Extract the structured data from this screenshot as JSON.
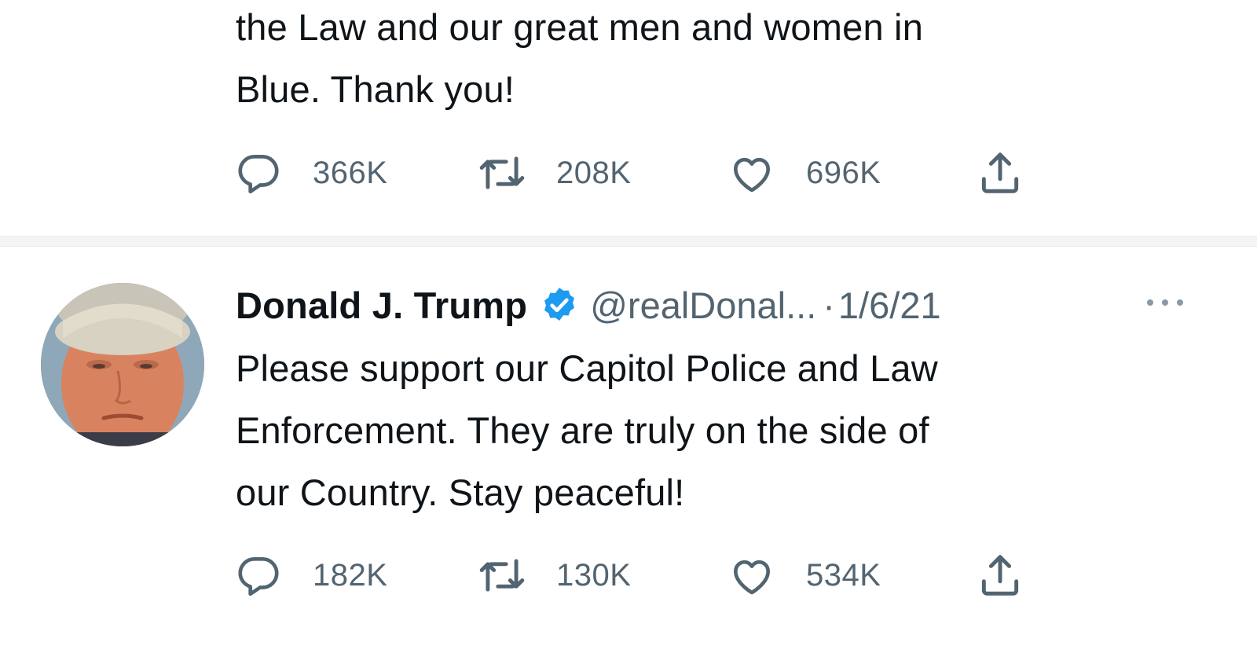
{
  "tweets": [
    {
      "text_lines": [
        "the Law and our great men and women in",
        "Blue. Thank you!"
      ],
      "actions": {
        "replies": "366K",
        "retweets": "208K",
        "likes": "696K"
      }
    },
    {
      "author": {
        "name": "Donald J. Trump",
        "handle": "@realDonal...",
        "verified": true
      },
      "separator": "·",
      "date": "1/6/21",
      "text_lines": [
        "Please support our Capitol Police and Law",
        "Enforcement. They are truly on the side of",
        "our Country. Stay peaceful!"
      ],
      "actions": {
        "replies": "182K",
        "retweets": "130K",
        "likes": "534K"
      }
    }
  ],
  "icons": {
    "reply": "reply-icon",
    "retweet": "retweet-icon",
    "like": "heart-icon",
    "share": "share-icon",
    "verified": "verified-badge-icon",
    "more": "more-icon"
  },
  "colors": {
    "text": "#0f1419",
    "secondary": "#536471",
    "verified": "#1d9bf0"
  }
}
